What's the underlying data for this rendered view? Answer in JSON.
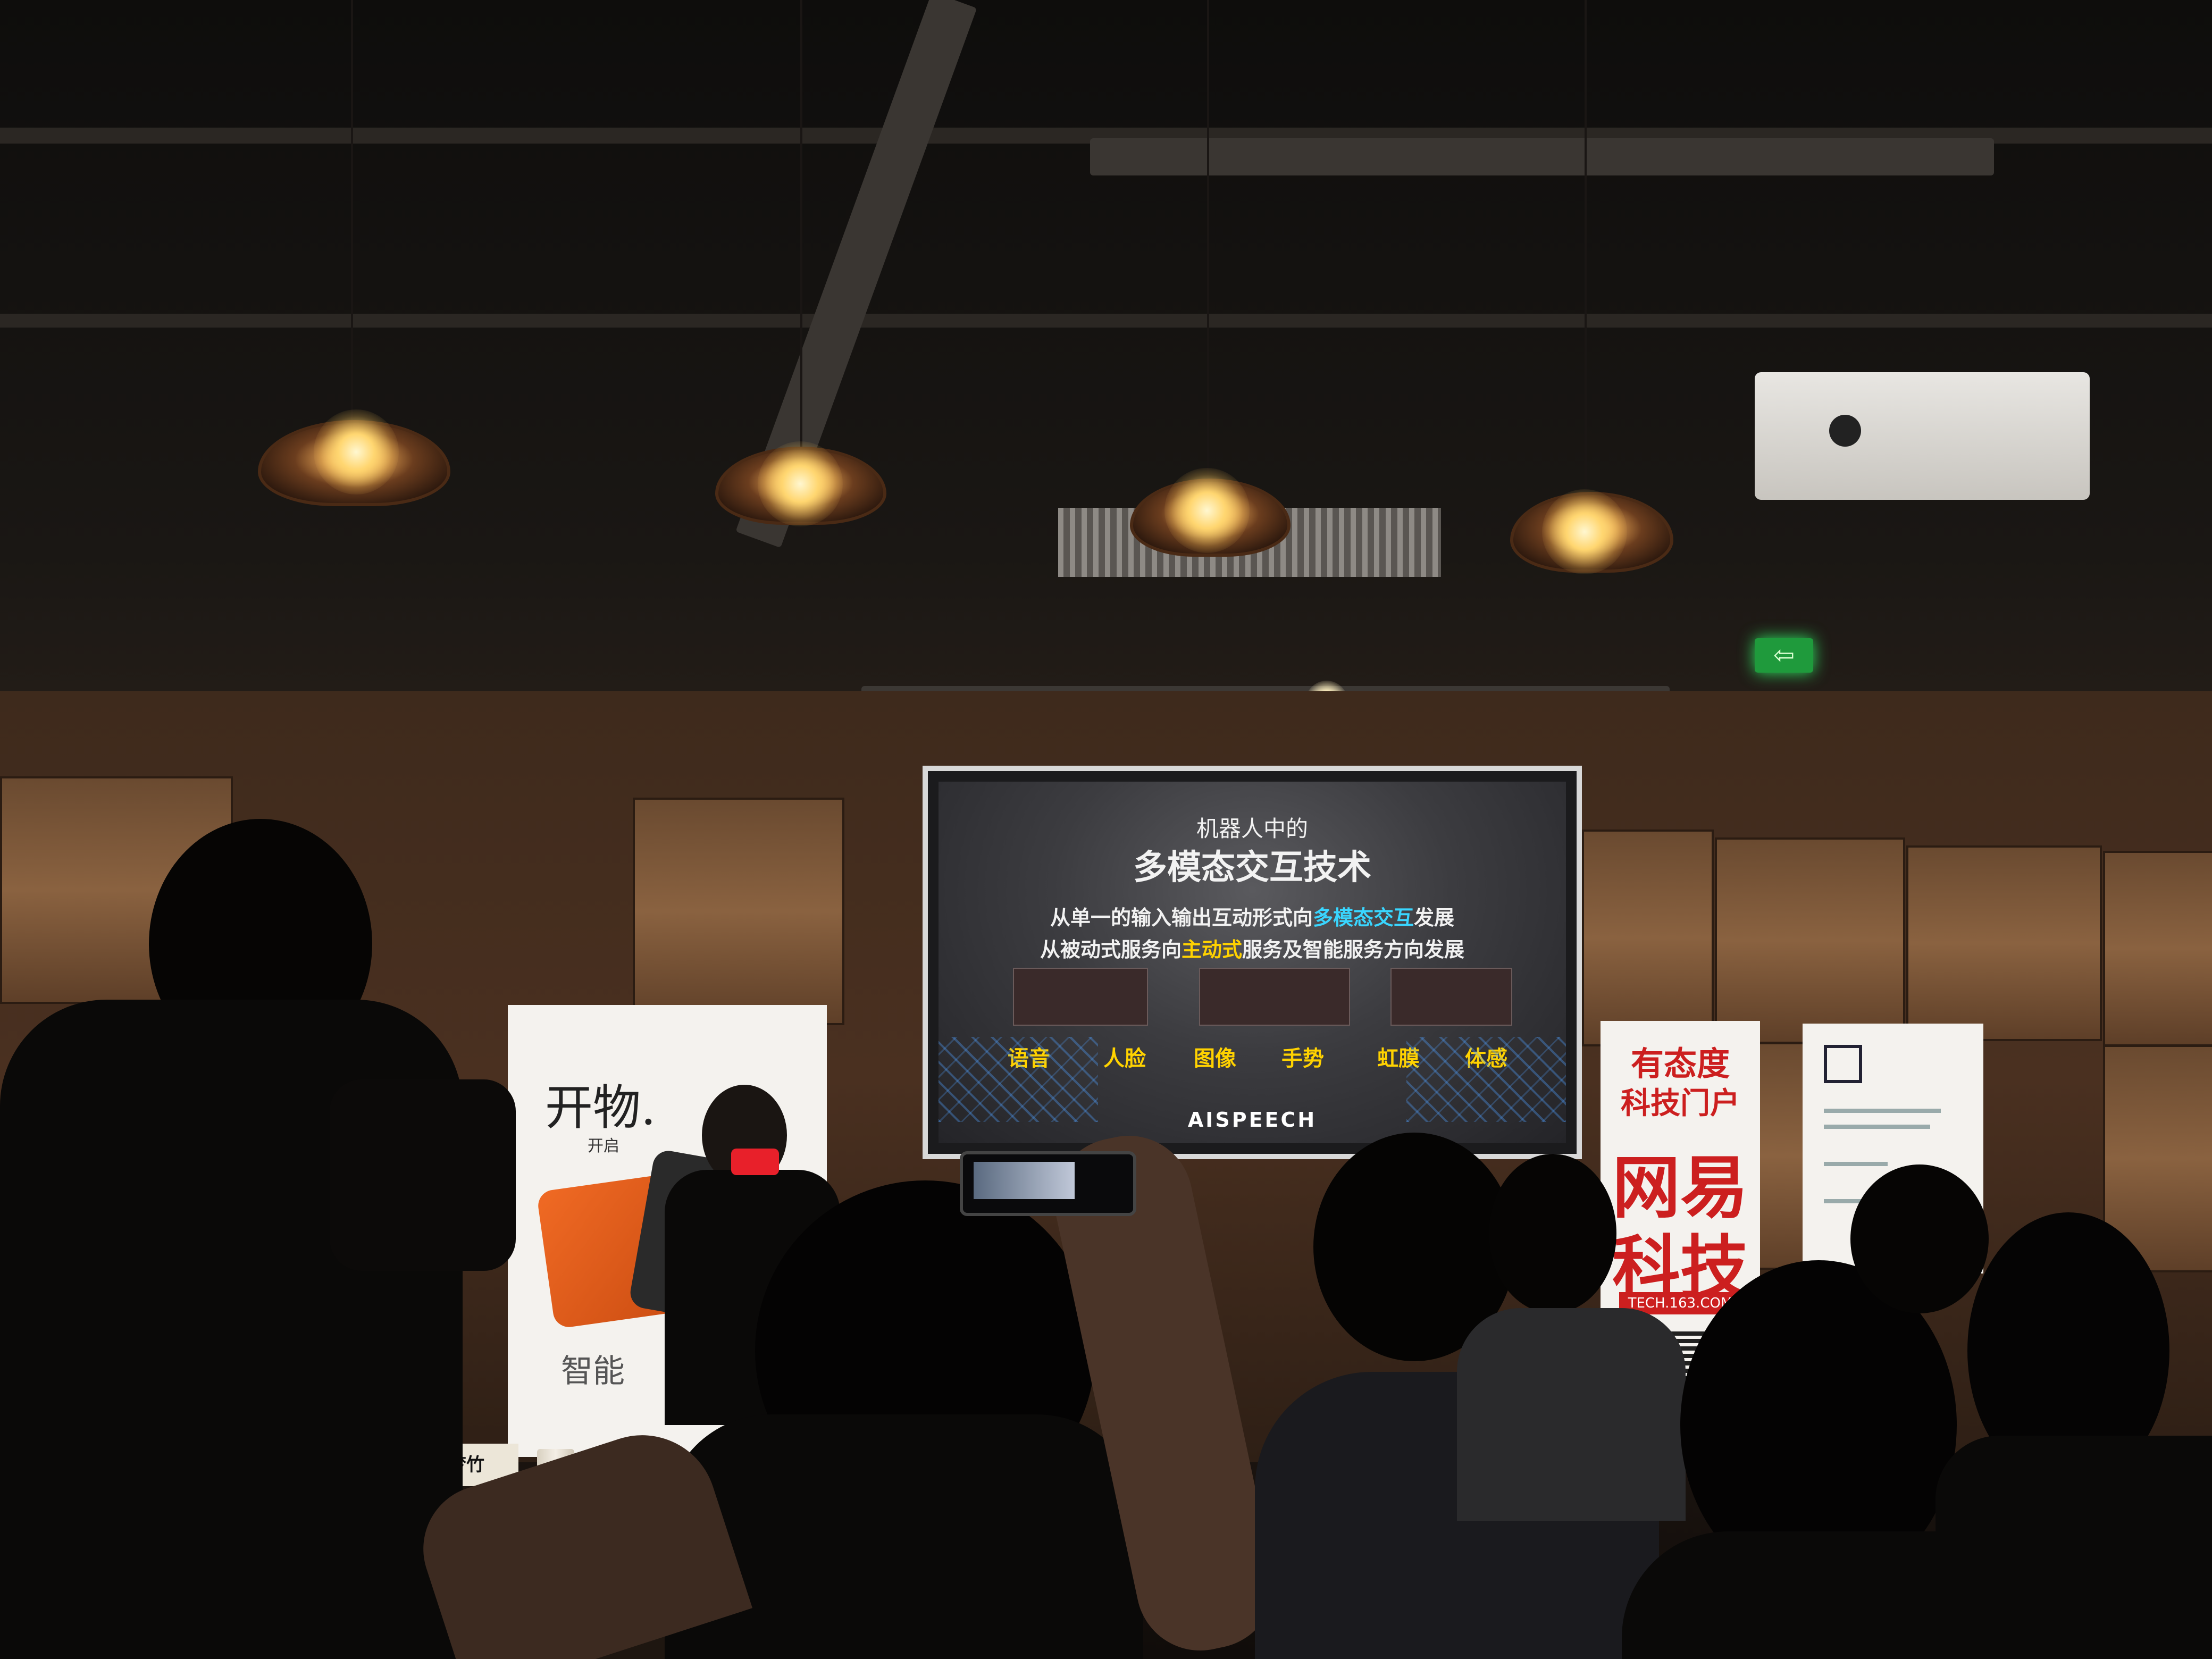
{
  "slide": {
    "subtitle": "机器人中的",
    "title": "多模态交互技术",
    "line1_pre": "从单一的输入输出互动形式向",
    "line1_hl": "多模态交互",
    "line1_post": "发展",
    "line2_pre": "从被动式服务向",
    "line2_hl": "主动式",
    "line2_post": "服务及智能服务方向发展",
    "keywords": [
      "语音",
      "人脸",
      "图像",
      "手势",
      "虹膜",
      "体感"
    ],
    "logo": "AISPEECH"
  },
  "banner_left": {
    "brand": "开物.",
    "sub": "开启",
    "tagline": "智能"
  },
  "banner_163": {
    "line1": "有态度",
    "line2": "科技门户",
    "line3": "网易",
    "line4": "科技",
    "url": "TECH.163.COM"
  },
  "name_card": "龙梦竹",
  "colors": {
    "highlight_cyan": "#39d6ff",
    "highlight_yellow": "#ffd200",
    "netease_red": "#cc1f1f",
    "exit_green": "#1f9a3c"
  }
}
